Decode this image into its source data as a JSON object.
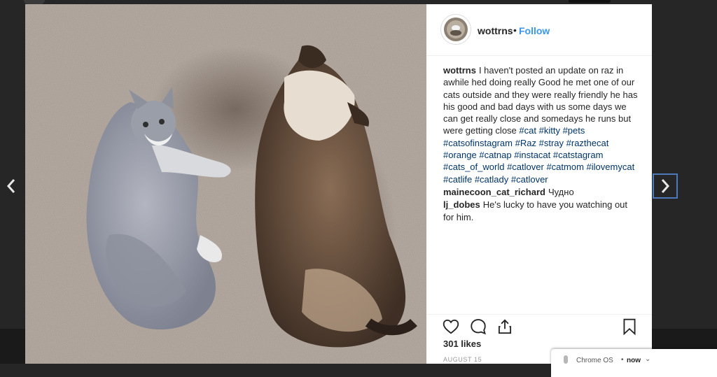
{
  "post": {
    "username": "wottrns",
    "separator": "•",
    "follow_label": "Follow",
    "likes": "301 likes",
    "date": "AUGUST 15"
  },
  "comments": [
    {
      "user": "wottrns",
      "segments": [
        {
          "text": "I haven't posted an update on raz in awhile hed doing really Good he met one of our cats outside and they were really friendly he has his good and bad days with us some days we can get really close and somedays he runs but were getting close "
        },
        {
          "text": "#cat",
          "tag": true
        },
        {
          "text": " "
        },
        {
          "text": "#kitty",
          "tag": true
        },
        {
          "text": " "
        },
        {
          "text": "#pets",
          "tag": true
        },
        {
          "text": " "
        },
        {
          "text": "#catsofinstagram",
          "tag": true
        },
        {
          "text": " "
        },
        {
          "text": "#Raz",
          "tag": true
        },
        {
          "text": " "
        },
        {
          "text": "#stray",
          "tag": true
        },
        {
          "text": " "
        },
        {
          "text": "#razthecat",
          "tag": true
        },
        {
          "text": " "
        },
        {
          "text": "#orange",
          "tag": true
        },
        {
          "text": " "
        },
        {
          "text": "#catnap",
          "tag": true
        },
        {
          "text": " "
        },
        {
          "text": "#instacat",
          "tag": true
        },
        {
          "text": " "
        },
        {
          "text": "#catstagram",
          "tag": true
        },
        {
          "text": " "
        },
        {
          "text": "#cats_of_world",
          "tag": true
        },
        {
          "text": " "
        },
        {
          "text": "#catlover",
          "tag": true
        },
        {
          "text": " "
        },
        {
          "text": "#catmom",
          "tag": true
        },
        {
          "text": " "
        },
        {
          "text": "#ilovemycat",
          "tag": true
        },
        {
          "text": " "
        },
        {
          "text": "#catlife",
          "tag": true
        },
        {
          "text": " "
        },
        {
          "text": "#catlady",
          "tag": true
        },
        {
          "text": " "
        },
        {
          "text": "#catlover",
          "tag": true
        }
      ]
    },
    {
      "user": "mainecoon_cat_richard",
      "segments": [
        {
          "text": "Чудно"
        }
      ]
    },
    {
      "user": "lj_dobes",
      "segments": [
        {
          "text": "He's lucky to have you watching out for him."
        }
      ]
    }
  ],
  "icons": {
    "like": "heart-icon",
    "comment": "comment-bubble-icon",
    "share": "share-icon",
    "save": "bookmark-icon",
    "prev": "chevron-left-icon",
    "next": "chevron-right-icon"
  },
  "notification": {
    "app": "Chrome OS",
    "separator": "•",
    "time": "now",
    "chevron": "⌄"
  },
  "colors": {
    "link_blue": "#3897f0",
    "hashtag": "#003569",
    "text": "#262626",
    "backdrop": "#262626"
  }
}
